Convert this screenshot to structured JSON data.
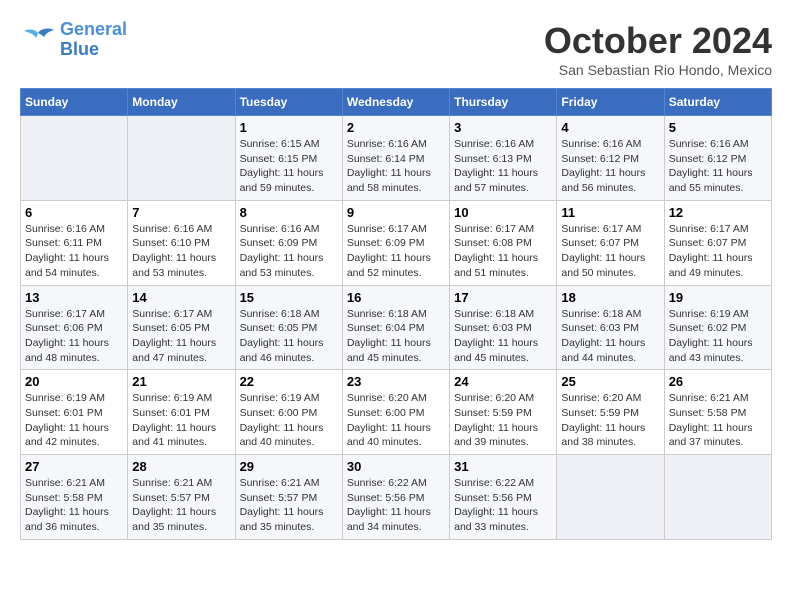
{
  "header": {
    "logo_line1": "General",
    "logo_line2": "Blue",
    "month": "October 2024",
    "location": "San Sebastian Rio Hondo, Mexico"
  },
  "weekdays": [
    "Sunday",
    "Monday",
    "Tuesday",
    "Wednesday",
    "Thursday",
    "Friday",
    "Saturday"
  ],
  "weeks": [
    [
      {
        "day": "",
        "empty": true
      },
      {
        "day": "",
        "empty": true
      },
      {
        "day": "1",
        "sunrise": "6:15 AM",
        "sunset": "6:15 PM",
        "daylight": "11 hours and 59 minutes."
      },
      {
        "day": "2",
        "sunrise": "6:16 AM",
        "sunset": "6:14 PM",
        "daylight": "11 hours and 58 minutes."
      },
      {
        "day": "3",
        "sunrise": "6:16 AM",
        "sunset": "6:13 PM",
        "daylight": "11 hours and 57 minutes."
      },
      {
        "day": "4",
        "sunrise": "6:16 AM",
        "sunset": "6:12 PM",
        "daylight": "11 hours and 56 minutes."
      },
      {
        "day": "5",
        "sunrise": "6:16 AM",
        "sunset": "6:12 PM",
        "daylight": "11 hours and 55 minutes."
      }
    ],
    [
      {
        "day": "6",
        "sunrise": "6:16 AM",
        "sunset": "6:11 PM",
        "daylight": "11 hours and 54 minutes."
      },
      {
        "day": "7",
        "sunrise": "6:16 AM",
        "sunset": "6:10 PM",
        "daylight": "11 hours and 53 minutes."
      },
      {
        "day": "8",
        "sunrise": "6:16 AM",
        "sunset": "6:09 PM",
        "daylight": "11 hours and 53 minutes."
      },
      {
        "day": "9",
        "sunrise": "6:17 AM",
        "sunset": "6:09 PM",
        "daylight": "11 hours and 52 minutes."
      },
      {
        "day": "10",
        "sunrise": "6:17 AM",
        "sunset": "6:08 PM",
        "daylight": "11 hours and 51 minutes."
      },
      {
        "day": "11",
        "sunrise": "6:17 AM",
        "sunset": "6:07 PM",
        "daylight": "11 hours and 50 minutes."
      },
      {
        "day": "12",
        "sunrise": "6:17 AM",
        "sunset": "6:07 PM",
        "daylight": "11 hours and 49 minutes."
      }
    ],
    [
      {
        "day": "13",
        "sunrise": "6:17 AM",
        "sunset": "6:06 PM",
        "daylight": "11 hours and 48 minutes."
      },
      {
        "day": "14",
        "sunrise": "6:17 AM",
        "sunset": "6:05 PM",
        "daylight": "11 hours and 47 minutes."
      },
      {
        "day": "15",
        "sunrise": "6:18 AM",
        "sunset": "6:05 PM",
        "daylight": "11 hours and 46 minutes."
      },
      {
        "day": "16",
        "sunrise": "6:18 AM",
        "sunset": "6:04 PM",
        "daylight": "11 hours and 45 minutes."
      },
      {
        "day": "17",
        "sunrise": "6:18 AM",
        "sunset": "6:03 PM",
        "daylight": "11 hours and 45 minutes."
      },
      {
        "day": "18",
        "sunrise": "6:18 AM",
        "sunset": "6:03 PM",
        "daylight": "11 hours and 44 minutes."
      },
      {
        "day": "19",
        "sunrise": "6:19 AM",
        "sunset": "6:02 PM",
        "daylight": "11 hours and 43 minutes."
      }
    ],
    [
      {
        "day": "20",
        "sunrise": "6:19 AM",
        "sunset": "6:01 PM",
        "daylight": "11 hours and 42 minutes."
      },
      {
        "day": "21",
        "sunrise": "6:19 AM",
        "sunset": "6:01 PM",
        "daylight": "11 hours and 41 minutes."
      },
      {
        "day": "22",
        "sunrise": "6:19 AM",
        "sunset": "6:00 PM",
        "daylight": "11 hours and 40 minutes."
      },
      {
        "day": "23",
        "sunrise": "6:20 AM",
        "sunset": "6:00 PM",
        "daylight": "11 hours and 40 minutes."
      },
      {
        "day": "24",
        "sunrise": "6:20 AM",
        "sunset": "5:59 PM",
        "daylight": "11 hours and 39 minutes."
      },
      {
        "day": "25",
        "sunrise": "6:20 AM",
        "sunset": "5:59 PM",
        "daylight": "11 hours and 38 minutes."
      },
      {
        "day": "26",
        "sunrise": "6:21 AM",
        "sunset": "5:58 PM",
        "daylight": "11 hours and 37 minutes."
      }
    ],
    [
      {
        "day": "27",
        "sunrise": "6:21 AM",
        "sunset": "5:58 PM",
        "daylight": "11 hours and 36 minutes."
      },
      {
        "day": "28",
        "sunrise": "6:21 AM",
        "sunset": "5:57 PM",
        "daylight": "11 hours and 35 minutes."
      },
      {
        "day": "29",
        "sunrise": "6:21 AM",
        "sunset": "5:57 PM",
        "daylight": "11 hours and 35 minutes."
      },
      {
        "day": "30",
        "sunrise": "6:22 AM",
        "sunset": "5:56 PM",
        "daylight": "11 hours and 34 minutes."
      },
      {
        "day": "31",
        "sunrise": "6:22 AM",
        "sunset": "5:56 PM",
        "daylight": "11 hours and 33 minutes."
      },
      {
        "day": "",
        "empty": true
      },
      {
        "day": "",
        "empty": true
      }
    ]
  ]
}
